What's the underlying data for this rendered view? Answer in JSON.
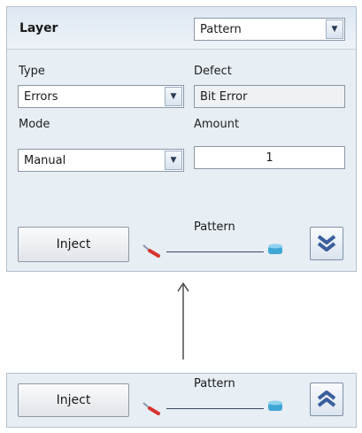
{
  "expanded": {
    "layer_label": "Layer",
    "layer_value": "Pattern",
    "type_label": "Type",
    "type_value": "Errors",
    "defect_label": "Defect",
    "defect_value": "Bit Error",
    "mode_label": "Mode",
    "mode_value": "Manual",
    "amount_label": "Amount",
    "amount_value": "1",
    "inject_label": "Inject",
    "pattern_label": "Pattern"
  },
  "collapsed": {
    "inject_label": "Inject",
    "pattern_label": "Pattern"
  },
  "icons": {
    "dropdown": "chevron-down-icon",
    "collapse": "double-chevron-down-icon",
    "expand": "double-chevron-up-icon",
    "slider_left": "syringe-icon",
    "slider_right": "cylinder-icon"
  },
  "colors": {
    "panel_bg": "#e7eef4",
    "chevron": "#3b5f9e"
  }
}
